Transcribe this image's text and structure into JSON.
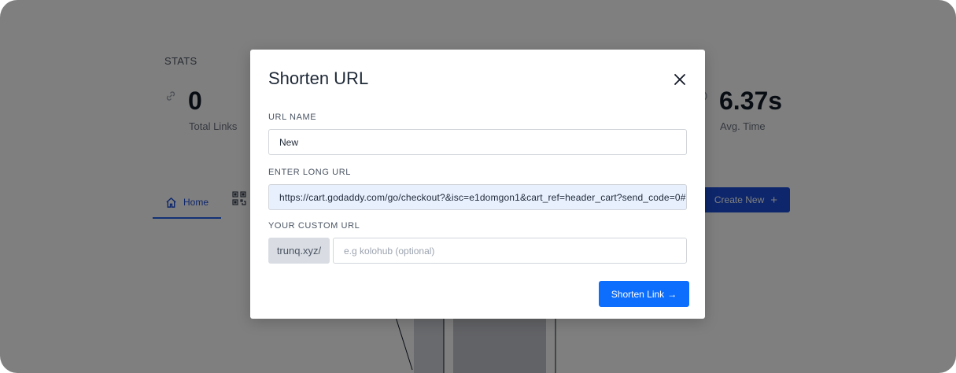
{
  "background": {
    "stats_heading": "STATS",
    "stats": [
      {
        "value": "0",
        "label": "Total Links",
        "icon": "link-icon"
      },
      {
        "value": "6.37s",
        "label": "Avg. Time",
        "icon": "clock-icon"
      }
    ],
    "tabs": [
      {
        "label": "Home",
        "icon": "home-icon",
        "active": true
      },
      {
        "label": "",
        "icon": "qr-code-icon",
        "active": false
      }
    ],
    "create_button": {
      "label": "Create New",
      "icon": "plus-icon"
    }
  },
  "modal": {
    "title": "Shorten URL",
    "close_icon": "close-icon",
    "fields": {
      "url_name": {
        "label": "URL NAME",
        "value": "New"
      },
      "long_url": {
        "label": "ENTER LONG URL",
        "value": "https://cart.godaddy.com/go/checkout?&isc=e1domgon1&cart_ref=header_cart?send_code=0#"
      },
      "custom_url": {
        "label": "YOUR CUSTOM URL",
        "prefix": "trunq.xyz/",
        "placeholder": "e.g kolohub (optional)",
        "value": ""
      }
    },
    "submit_button": {
      "label": "Shorten Link",
      "icon": "arrow-right-icon"
    }
  },
  "colors": {
    "accent": "#0d6efd",
    "nav_active": "#1d4ed8",
    "autofill_bg": "#e8f0fe",
    "overlay": "rgba(0,0,0,0.5)"
  }
}
